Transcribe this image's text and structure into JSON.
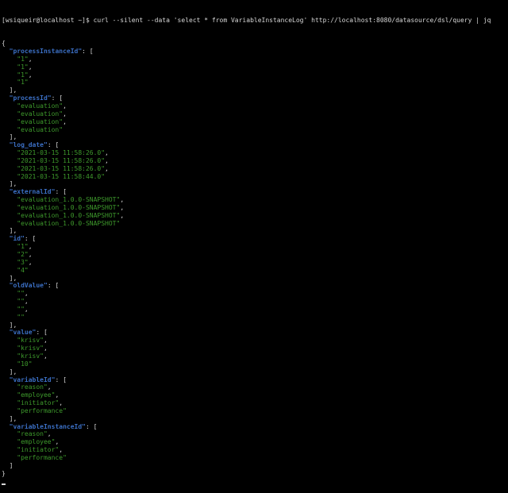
{
  "prompt": "[wsiqueir@localhost ~]$ ",
  "command": "curl --silent --data 'select * from VariableInstanceLog' http://localhost:8080/datasource/dsl/query | jq",
  "fields": [
    {
      "key": "processInstanceId",
      "values": [
        "1",
        "1",
        "1",
        "1"
      ]
    },
    {
      "key": "processId",
      "values": [
        "evaluation",
        "evaluation",
        "evaluation",
        "evaluation"
      ]
    },
    {
      "key": "log_date",
      "values": [
        "2021-03-15 11:58:26.0",
        "2021-03-15 11:58:26.0",
        "2021-03-15 11:58:26.0",
        "2021-03-15 11:58:44.0"
      ]
    },
    {
      "key": "externalId",
      "values": [
        "evaluation_1.0.0-SNAPSHOT",
        "evaluation_1.0.0-SNAPSHOT",
        "evaluation_1.0.0-SNAPSHOT",
        "evaluation_1.0.0-SNAPSHOT"
      ]
    },
    {
      "key": "id",
      "values": [
        "1",
        "2",
        "3",
        "4"
      ]
    },
    {
      "key": "oldValue",
      "values": [
        "",
        "",
        "",
        ""
      ]
    },
    {
      "key": "value",
      "values": [
        "krisv",
        "krisv",
        "krisv",
        "10"
      ]
    },
    {
      "key": "variableId",
      "values": [
        "reason",
        "employee",
        "initiator",
        "performance"
      ]
    },
    {
      "key": "variableInstanceId",
      "values": [
        "reason",
        "employee",
        "initiator",
        "performance"
      ]
    }
  ],
  "colors": {
    "background": "#000000",
    "text": "#d6d6d6",
    "key": "#3b6fc4",
    "string": "#3e9a2c"
  }
}
